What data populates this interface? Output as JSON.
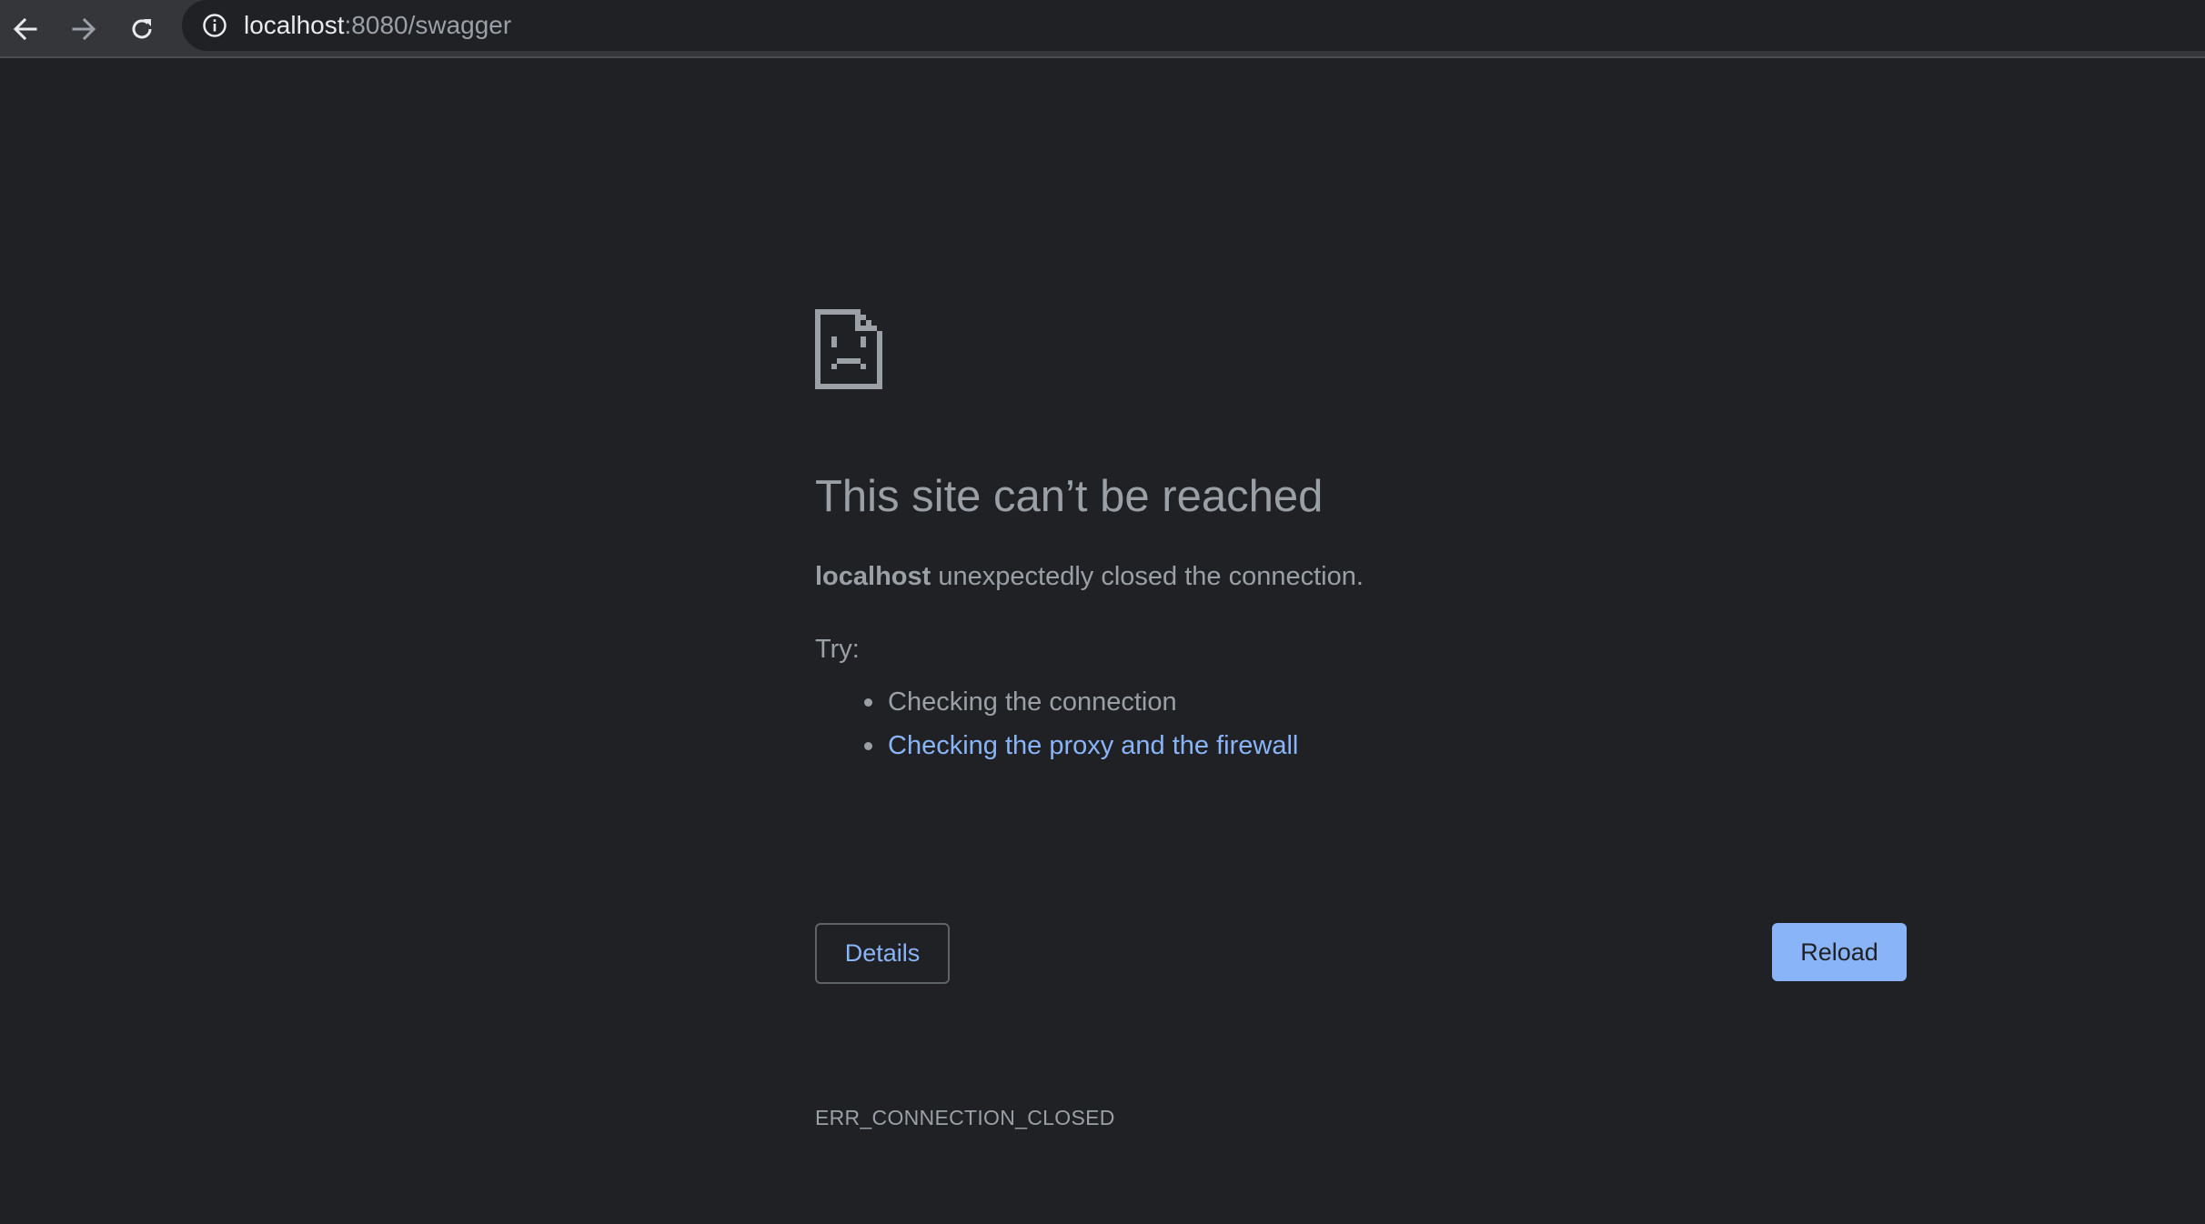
{
  "browser": {
    "url_host": "localhost",
    "url_rest": ":8080/swagger",
    "icons": {
      "back": "arrow-left-icon",
      "forward": "arrow-right-icon",
      "reload": "refresh-icon",
      "site_info": "info-circle-icon"
    }
  },
  "error_page": {
    "icon": "sad-document-icon",
    "headline": "This site can’t be reached",
    "summary_host": "localhost",
    "summary_rest": " unexpectedly closed the connection.",
    "try_label": "Try:",
    "suggestions": [
      "Checking the connection",
      "Checking the proxy and the firewall"
    ],
    "error_code": "ERR_CONNECTION_CLOSED",
    "details_label": "Details",
    "reload_label": "Reload"
  },
  "colors": {
    "background": "#202124",
    "toolbar": "#35363a",
    "text": "#9aa0a6",
    "link": "#8ab4f8",
    "primary_button": "#8ab4f8"
  }
}
